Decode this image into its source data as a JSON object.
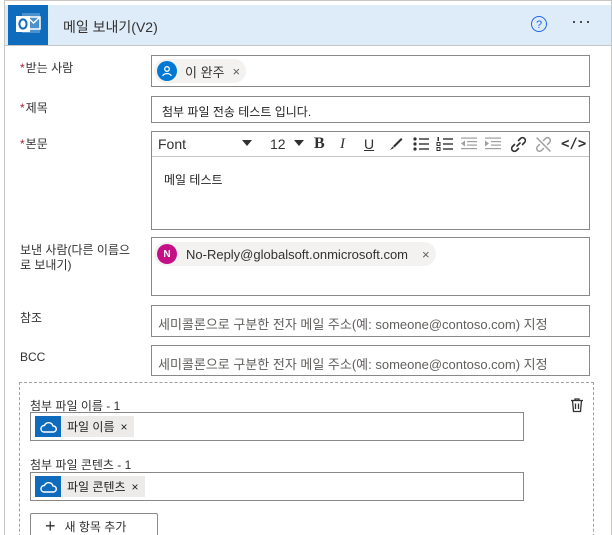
{
  "header": {
    "title": "메일 보내기(V2)",
    "help_glyph": "?",
    "more_glyph": "···"
  },
  "fields": {
    "to": {
      "label": "받는 사람",
      "required": "*",
      "recipient": "이 완주",
      "remove": "×"
    },
    "subject": {
      "label": "제목",
      "required": "*",
      "value": "첨부 파일 전송 테스트 입니다."
    },
    "body": {
      "label": "본문",
      "required": "*",
      "font": "Font",
      "size": "12",
      "content": "메일 테스트",
      "bold": "B",
      "italic": "I",
      "underline": "U",
      "code": "</>"
    },
    "from": {
      "label": "보낸 사람(다른 이름으로 보내기)",
      "avatar_letter": "N",
      "address": "No-Reply@globalsoft.onmicrosoft.com",
      "remove": "×"
    },
    "cc": {
      "label": "참조",
      "placeholder": "세미콜론으로 구분한 전자 메일 주소(예: someone@contoso.com) 지정"
    },
    "bcc": {
      "label": "BCC",
      "placeholder": "세미콜론으로 구분한 전자 메일 주소(예: someone@contoso.com) 지정"
    }
  },
  "attachments": {
    "name_label": "첨부 파일 이름 - 1",
    "name_token": "파일 이름",
    "content_label": "첨부 파일 콘텐츠 - 1",
    "content_token": "파일 콘텐츠",
    "remove": "×",
    "add_plus": "+",
    "add_button": "새 항목 추가"
  },
  "colors": {
    "accent": "#0f6cbd",
    "header_bg": "#deecf9",
    "required": "#a4262c",
    "person_avatar": "#0078d4",
    "n_avatar": "#c50f87"
  }
}
